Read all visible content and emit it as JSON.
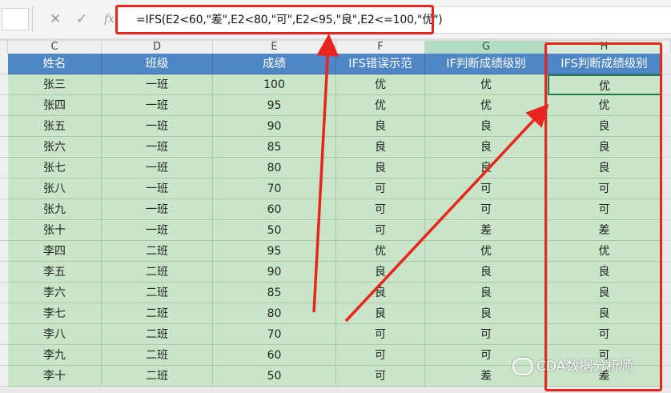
{
  "formula_bar": {
    "cancel_icon": "✕",
    "confirm_icon": "✓",
    "fx_label": "fx",
    "formula": "=IFS(E2<60,\"差\",E2<80,\"可\",E2<95,\"良\",E2<=100,\"优\")"
  },
  "columns": [
    "C",
    "D",
    "E",
    "F",
    "G",
    "H"
  ],
  "selected_columns": [
    "G",
    "H"
  ],
  "table": {
    "headers": [
      "姓名",
      "班级",
      "成绩",
      "IFS错误示范",
      "IF判断成绩级别",
      "IFS判断成绩级别"
    ],
    "rows": [
      [
        "张三",
        "一班",
        "100",
        "优",
        "优",
        "优"
      ],
      [
        "张四",
        "一班",
        "95",
        "优",
        "优",
        "优"
      ],
      [
        "张五",
        "一班",
        "90",
        "良",
        "良",
        "良"
      ],
      [
        "张六",
        "一班",
        "85",
        "良",
        "良",
        "良"
      ],
      [
        "张七",
        "一班",
        "80",
        "良",
        "良",
        "良"
      ],
      [
        "张八",
        "一班",
        "70",
        "可",
        "可",
        "可"
      ],
      [
        "张九",
        "一班",
        "60",
        "可",
        "可",
        "可"
      ],
      [
        "张十",
        "一班",
        "50",
        "可",
        "差",
        "差"
      ],
      [
        "李四",
        "二班",
        "95",
        "优",
        "优",
        "优"
      ],
      [
        "李五",
        "二班",
        "90",
        "良",
        "良",
        "良"
      ],
      [
        "李六",
        "二班",
        "85",
        "良",
        "良",
        "良"
      ],
      [
        "李七",
        "二班",
        "80",
        "良",
        "良",
        "良"
      ],
      [
        "李八",
        "二班",
        "70",
        "可",
        "可",
        "可"
      ],
      [
        "李九",
        "二班",
        "60",
        "可",
        "可",
        "可"
      ],
      [
        "李十",
        "二班",
        "50",
        "可",
        "差",
        "差"
      ]
    ]
  },
  "watermark": "CDA数据分析师",
  "colors": {
    "header_fill": "#4e86c6",
    "cell_fill": "#c8e5c7",
    "highlight_red": "#e8261e",
    "selected_col_header": "#b4dcc4"
  }
}
